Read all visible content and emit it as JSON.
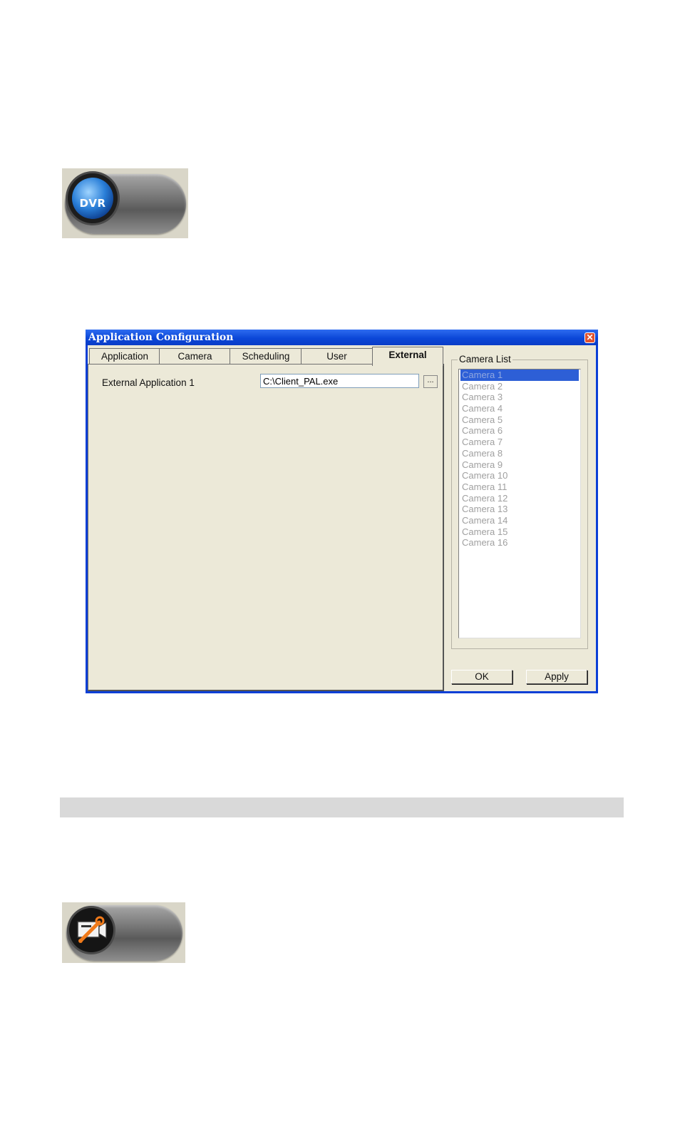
{
  "dvr_button": {
    "label": "DVR"
  },
  "dialog": {
    "title": "Application Configuration",
    "close_symbol": "✕",
    "tabs": [
      {
        "label": "Application"
      },
      {
        "label": "Camera"
      },
      {
        "label": "Scheduling"
      },
      {
        "label": "User"
      },
      {
        "label": "External",
        "active": true
      }
    ],
    "external": {
      "label": "External Application 1",
      "path_value": "C:\\Client_PAL.exe",
      "browse_label": "..."
    },
    "camera_list": {
      "title": "Camera List",
      "selected_index": 0,
      "items": [
        "Camera 1",
        "Camera 2",
        "Camera 3",
        "Camera 4",
        "Camera 5",
        "Camera 6",
        "Camera 7",
        "Camera 8",
        "Camera 9",
        "Camera 10",
        "Camera 11",
        "Camera 12",
        "Camera 13",
        "Camera 14",
        "Camera 15",
        "Camera 16"
      ]
    },
    "ok_label": "OK",
    "apply_label": "Apply"
  },
  "tool_button": {
    "icon": "camera-settings-icon"
  }
}
